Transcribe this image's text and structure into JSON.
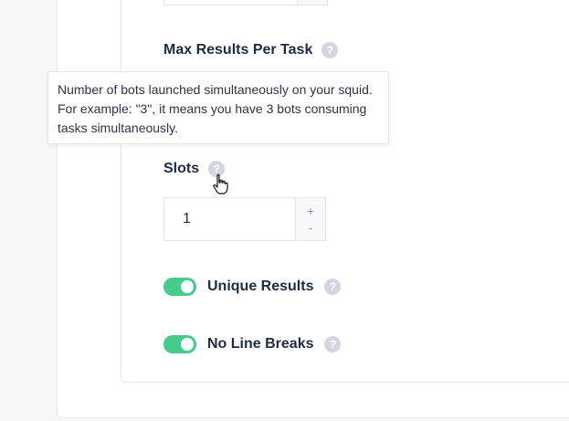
{
  "fields": {
    "max_results": {
      "label": "Max Results Per Task",
      "help_icon": "question-icon"
    },
    "slots": {
      "label": "Slots",
      "value": "1",
      "increment": "+",
      "decrement": "-",
      "help_icon": "question-icon"
    }
  },
  "toggles": [
    {
      "label": "Unique Results",
      "on": true
    },
    {
      "label": "No Line Breaks",
      "on": true
    }
  ],
  "tooltip": {
    "text": "Number of bots launched simultaneously on your squid. For example: \"3\", it means you have 3 bots consuming tasks simultaneously."
  },
  "help_glyph": "?",
  "colors": {
    "toggle_on": "#45cc8a",
    "help_icon": "#d3d6e0",
    "text": "#1d2b45"
  },
  "cursor": "hand-pointer-icon"
}
